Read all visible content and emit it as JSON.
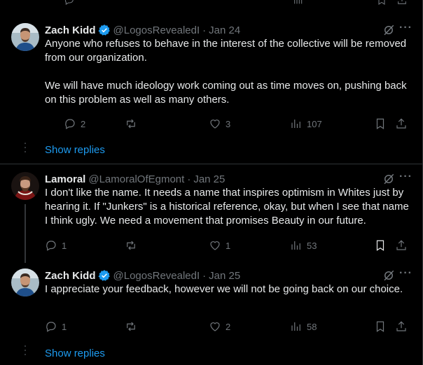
{
  "tweets": [
    {
      "name": "Zach Kidd",
      "verified": true,
      "handle": "@LogosRevealedI",
      "date": "Jan 24",
      "text": [
        "Anyone who refuses to behave in the interest of the collective will be removed from our organization.",
        "We will have much ideology work coming out as time moves on, pushing back on this problem as well as many others."
      ],
      "replies": "2",
      "reposts": "",
      "likes": "3",
      "views": "107"
    },
    {
      "name": "Lamoral",
      "verified": false,
      "handle": "@LamoralOfEgmont",
      "date": "Jan 25",
      "text": [
        "I don't like the name. It needs a name that inspires optimism in Whites just by hearing it. If \"Junkers\" is a historical reference, okay, but when I see that name I think ugly. We need a movement that promises Beauty in our future."
      ],
      "replies": "1",
      "reposts": "",
      "likes": "1",
      "views": "53"
    },
    {
      "name": "Zach Kidd",
      "verified": true,
      "handle": "@LogosRevealedI",
      "date": "Jan 25",
      "text": [
        "I appreciate your feedback, however we will not be going back on our choice."
      ],
      "replies": "1",
      "reposts": "",
      "likes": "2",
      "views": "58"
    }
  ],
  "show_replies_label": "Show replies",
  "dot_separator": "·",
  "more_label": "···",
  "colors": {
    "background": "#000000",
    "text": "#e7e9ea",
    "muted": "#71767b",
    "link": "#1d9bf0",
    "verified": "#1d9bf0",
    "divider": "#2f3336"
  },
  "icons": [
    "grok-icon",
    "more-icon",
    "reply-icon",
    "repost-icon",
    "like-icon",
    "views-icon",
    "bookmark-icon",
    "share-icon",
    "verified-badge-icon"
  ]
}
